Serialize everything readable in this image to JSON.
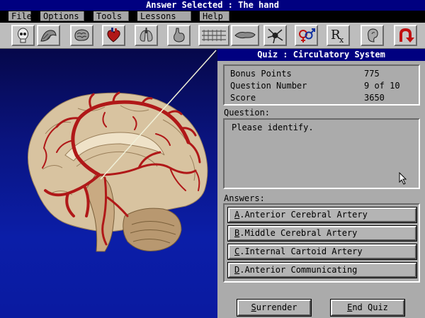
{
  "window": {
    "title": "Answer Selected : The hand"
  },
  "menu": [
    {
      "label": "File"
    },
    {
      "label": "Options"
    },
    {
      "label": "Tools"
    },
    {
      "label": "Lessons"
    },
    {
      "label": "Help"
    }
  ],
  "toolbar": {
    "icons": [
      "skull-icon",
      "muscle-arm-icon",
      "brain-icon",
      "heart-icon",
      "lungs-icon",
      "stomach-icon",
      "nerves-icon",
      "pancreas-icon",
      "neuron-icon",
      "gender-symbols-icon",
      "prescription-rx-icon",
      "ear-icon",
      "return-arrow-icon"
    ]
  },
  "quiz": {
    "title": "Quiz : Circulatory System",
    "bonus_label": "Bonus Points",
    "bonus_value": "775",
    "question_number_label": "Question Number",
    "question_number_value": "9 of 10",
    "score_label": "Score",
    "score_value": "3650",
    "question_label": "Question:",
    "question_text": "Please identify.",
    "answers_label": "Answers:",
    "answers": [
      {
        "key": "A",
        "text": ".Anterior Cerebral Artery"
      },
      {
        "key": "B",
        "text": ".Middle Cerebral Artery"
      },
      {
        "key": "C",
        "text": ".Internal Cartoid Artery"
      },
      {
        "key": "D",
        "text": ".Anterior Communicating"
      }
    ],
    "surrender_key": "S",
    "surrender_rest": "urrender",
    "endquiz_key": "E",
    "endquiz_rest": "nd Quiz"
  },
  "colors": {
    "title_bar": "#000080",
    "panel": "#ababab",
    "artery": "#b01818",
    "brain": "#d8c3a0"
  }
}
